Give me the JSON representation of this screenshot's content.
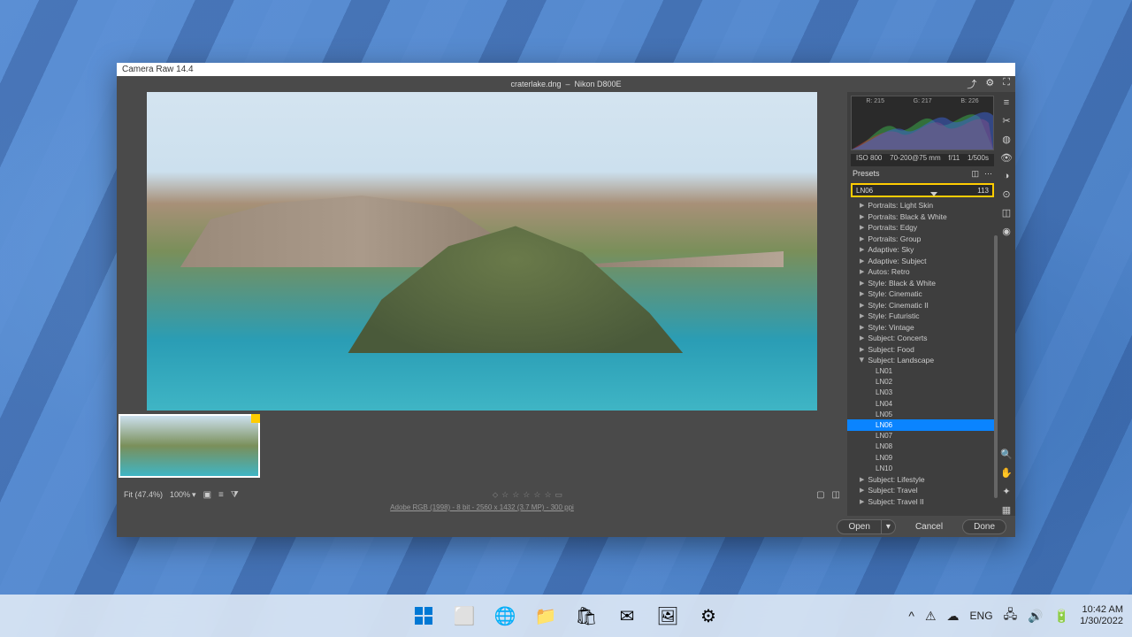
{
  "window": {
    "title": "Camera Raw 14.4"
  },
  "doc": {
    "filename": "craterlake.dng",
    "camera": "Nikon D800E"
  },
  "header_icons": [
    "share",
    "settings",
    "fullscreen"
  ],
  "exif": {
    "iso": "ISO 800",
    "lens": "70-200@75 mm",
    "aperture": "f/11",
    "shutter": "1/500s"
  },
  "hist_labels": {
    "r": "R: 215",
    "g": "G: 217",
    "b": "B: 226"
  },
  "panel": {
    "title": "Presets"
  },
  "amount": {
    "label": "LN06",
    "value": "113"
  },
  "preset_groups": [
    {
      "label": "Portraits: Light Skin",
      "expanded": false
    },
    {
      "label": "Portraits: Black & White",
      "expanded": false
    },
    {
      "label": "Portraits: Edgy",
      "expanded": false
    },
    {
      "label": "Portraits: Group",
      "expanded": false
    },
    {
      "label": "Adaptive: Sky",
      "expanded": false
    },
    {
      "label": "Adaptive: Subject",
      "expanded": false
    },
    {
      "label": "Autos: Retro",
      "expanded": false
    },
    {
      "label": "Style: Black & White",
      "expanded": false
    },
    {
      "label": "Style: Cinematic",
      "expanded": false
    },
    {
      "label": "Style: Cinematic II",
      "expanded": false
    },
    {
      "label": "Style: Futuristic",
      "expanded": false
    },
    {
      "label": "Style: Vintage",
      "expanded": false
    },
    {
      "label": "Subject: Concerts",
      "expanded": false
    },
    {
      "label": "Subject: Food",
      "expanded": false
    },
    {
      "label": "Subject: Landscape",
      "expanded": true,
      "children": [
        "LN01",
        "LN02",
        "LN03",
        "LN04",
        "LN05",
        "LN06",
        "LN07",
        "LN08",
        "LN09",
        "LN10"
      ],
      "selected": "LN06"
    },
    {
      "label": "Subject: Lifestyle",
      "expanded": false
    },
    {
      "label": "Subject: Travel",
      "expanded": false
    },
    {
      "label": "Subject: Travel II",
      "expanded": false
    }
  ],
  "bottombar": {
    "fit": "Fit (47.4%)",
    "zoom": "100%"
  },
  "info": "Adobe RGB (1998) - 8 bit - 2560 x 1432 (3.7 MP) - 300 ppi",
  "buttons": {
    "open": "Open",
    "cancel": "Cancel",
    "done": "Done"
  },
  "taskbar": {
    "lang": "ENG",
    "time": "10:42 AM",
    "date": "1/30/2022"
  }
}
